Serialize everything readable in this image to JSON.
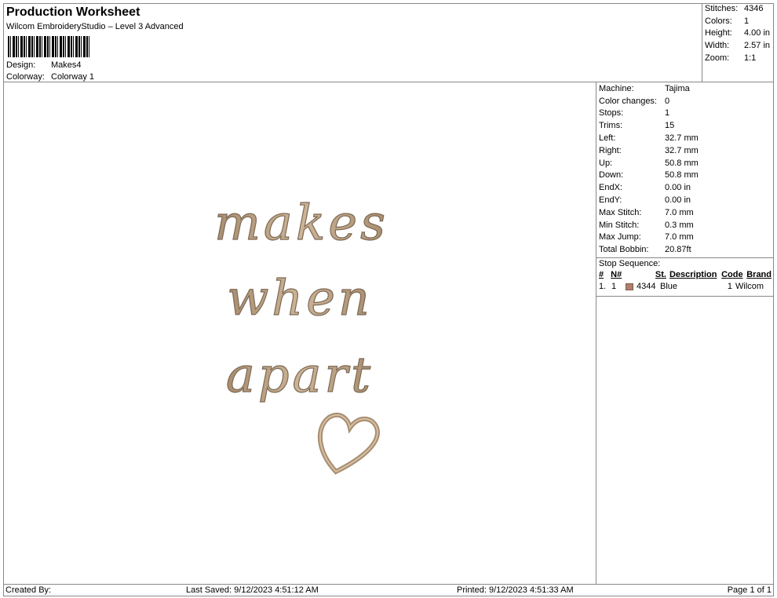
{
  "header": {
    "title": "Production Worksheet",
    "subtitle": "Wilcom EmbroideryStudio – Level 3 Advanced",
    "design_label": "Design:",
    "design": "Makes4",
    "colorway_label": "Colorway:",
    "colorway": "Colorway 1"
  },
  "summary": [
    {
      "k": "Stitches:",
      "v": "4346"
    },
    {
      "k": "Colors:",
      "v": "1"
    },
    {
      "k": "Height:",
      "v": "4.00 in"
    },
    {
      "k": "Width:",
      "v": "2.57 in"
    },
    {
      "k": "Zoom:",
      "v": "1:1"
    }
  ],
  "details": [
    {
      "k": "Machine:",
      "v": "Tajima"
    },
    {
      "k": "Color changes:",
      "v": "0"
    },
    {
      "k": "Stops:",
      "v": "1"
    },
    {
      "k": "Trims:",
      "v": "15"
    },
    {
      "k": "Left:",
      "v": "32.7 mm"
    },
    {
      "k": "Right:",
      "v": "32.7 mm"
    },
    {
      "k": "Up:",
      "v": "50.8 mm"
    },
    {
      "k": "Down:",
      "v": "50.8 mm"
    },
    {
      "k": "EndX:",
      "v": "0.00 in"
    },
    {
      "k": "EndY:",
      "v": "0.00 in"
    },
    {
      "k": "Max Stitch:",
      "v": "7.0 mm"
    },
    {
      "k": "Min Stitch:",
      "v": "0.3 mm"
    },
    {
      "k": "Max Jump:",
      "v": "7.0 mm"
    },
    {
      "k": "Total Bobbin:",
      "v": "20.87ft"
    }
  ],
  "stop_sequence": {
    "label": "Stop Sequence:",
    "headers": [
      "#",
      "N#",
      "St.",
      "Description",
      "Code",
      "Brand"
    ],
    "rows": [
      {
        "num": "1.",
        "n": "1",
        "color": "#b07f6c",
        "st": "4344",
        "desc": "Blue",
        "code": "1",
        "brand": "Wilcom"
      }
    ]
  },
  "design_text": [
    "makes",
    "when",
    "apart"
  ],
  "thread_color": "#bda184",
  "footer": {
    "created": "Created By:",
    "saved": "Last Saved: 9/12/2023 4:51:12 AM",
    "printed": "Printed: 9/12/2023 4:51:33 AM",
    "page": "Page 1 of 1"
  }
}
